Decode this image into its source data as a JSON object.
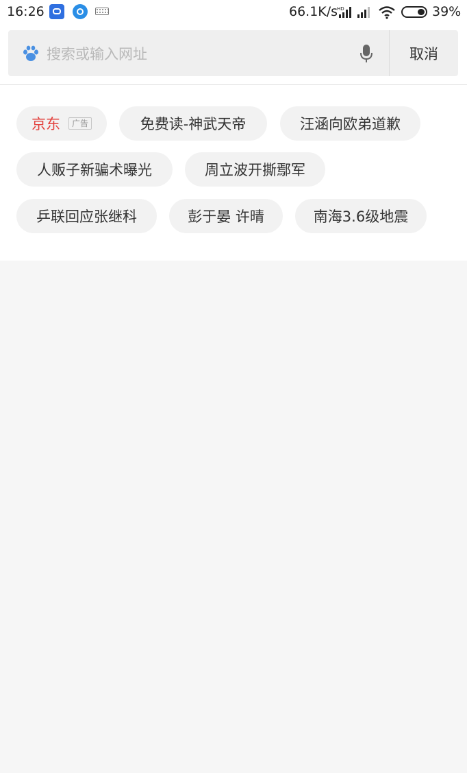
{
  "status_bar": {
    "time": "16:26",
    "network_speed": "66.1K/s",
    "battery": "39%"
  },
  "search": {
    "placeholder": "搜索或输入网址",
    "cancel_label": "取消"
  },
  "suggestions": [
    {
      "label": "京东",
      "ad_badge": "广告"
    },
    {
      "label": "免费读-神武天帝"
    },
    {
      "label": "汪涵向欧弟道歉"
    },
    {
      "label": "人贩子新骗术曝光"
    },
    {
      "label": "周立波开撕鄢军"
    },
    {
      "label": "乒联回应张继科"
    },
    {
      "label": "彭于晏 许晴"
    },
    {
      "label": "南海3.6级地震"
    }
  ],
  "colors": {
    "ad_text": "#e3423e",
    "paw_icon": "#4a90e2",
    "background": "#f6f6f6"
  },
  "icons": [
    "paw-icon",
    "mic-icon",
    "wifi-icon",
    "signal-icon",
    "battery-icon",
    "keyboard-icon"
  ]
}
